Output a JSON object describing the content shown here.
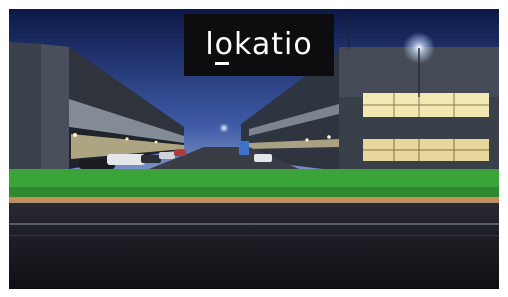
{
  "logo": {
    "text": "lokatio"
  },
  "colors": {
    "sky_top": "#101b45",
    "sky_bottom": "#4d6ab5",
    "grass": "#3aa33a",
    "road": "#16171d",
    "building": "#3a3f48",
    "window_light": "#f3e7b4",
    "logo_bg": "#0d0d0f"
  }
}
